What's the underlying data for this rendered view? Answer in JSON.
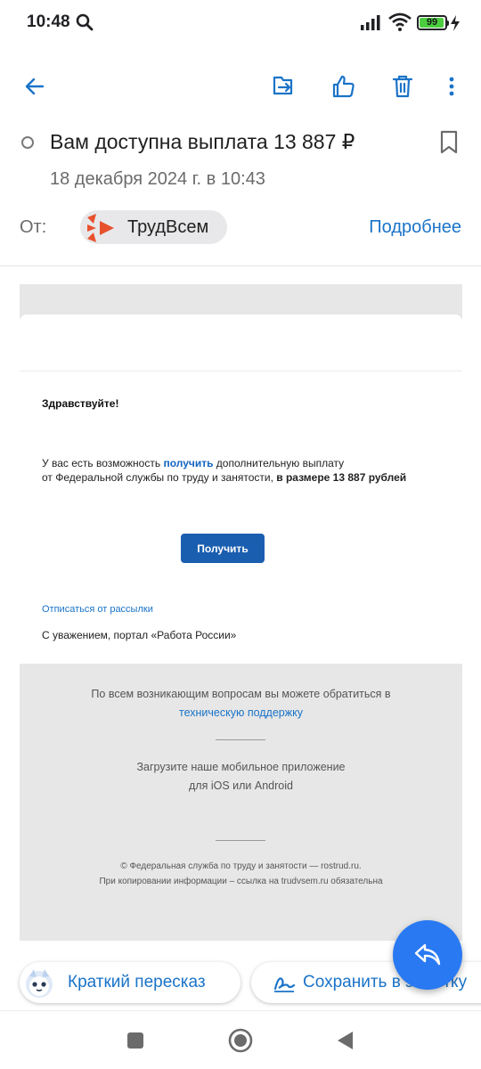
{
  "status_bar": {
    "time": "10:48",
    "battery": "99",
    "icons": [
      "search-icon",
      "signal-icon",
      "wifi-icon",
      "battery-icon",
      "charging-icon"
    ]
  },
  "toolbar": {
    "icons": [
      "back-arrow-icon",
      "move-to-folder-icon",
      "thumbs-up-icon",
      "trash-icon",
      "more-vert-icon"
    ]
  },
  "header": {
    "subject": "Вам доступна выплата 13 887 ₽",
    "date": "18 декабря 2024 г. в 10:43",
    "from_label": "От:",
    "sender_name": "ТрудВсем",
    "details_link": "Подробнее"
  },
  "mail": {
    "greeting": "Здравствуйте!",
    "line1_before": "У вас есть возможность ",
    "line1_link": "получить",
    "line1_after": " дополнительную выплату",
    "line2_before": "от Федеральной службы по труду и занятости, ",
    "line2_bold": "в размере 13 887 рублей",
    "button_label": "Получить",
    "unsubscribe": "Отписаться от рассылки",
    "signature": "С уважением, портал «Работа России»"
  },
  "footer": {
    "support_text": "По всем возникающим вопросам вы можете обратиться в",
    "support_link": "техническую поддержку",
    "app_line1": "Загрузите наше мобильное приложение",
    "app_line2": "для iOS или Android",
    "copyright": "© Федеральная служба по труду и занятости — rostrud.ru.",
    "copy_notice": "При копировании информации – ссылка на trudvsem.ru обязательна"
  },
  "actions": {
    "summary_label": "Краткий пересказ",
    "save_label": "Сохранить в заметку"
  },
  "colors": {
    "accent": "#1a73c8",
    "fab": "#2979f2",
    "button": "#1a5eb0",
    "logo": "#e8512e"
  }
}
